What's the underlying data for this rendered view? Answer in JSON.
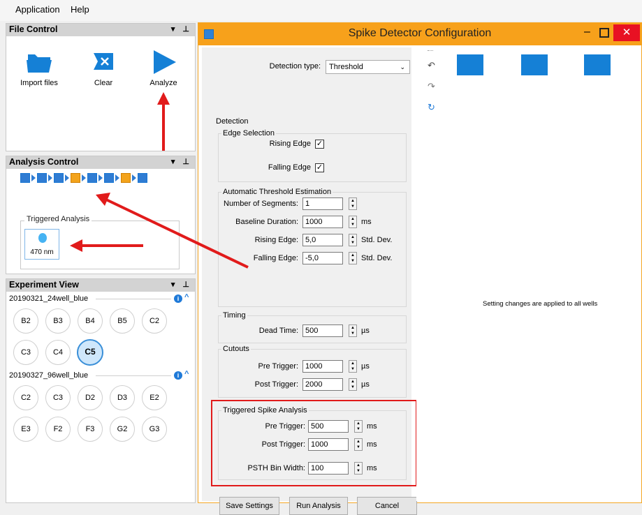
{
  "menu": {
    "items": [
      "Application",
      "Help"
    ]
  },
  "file_control": {
    "title": "File Control",
    "buttons": {
      "import": "Import files",
      "clear": "Clear",
      "analyze": "Analyze"
    }
  },
  "analysis_control": {
    "title": "Analysis Control",
    "triggered_title": "Triggered Analysis",
    "wavelength": "470 nm"
  },
  "experiment_view": {
    "title": "Experiment View",
    "groups": [
      {
        "name": "20190321_24well_blue",
        "rows": [
          [
            "B2",
            "B3",
            "B4",
            "B5",
            "C2"
          ],
          [
            "C3",
            "C4",
            "C5"
          ]
        ],
        "selected": "C5"
      },
      {
        "name": "20190327_96well_blue",
        "rows": [
          [
            "C2",
            "C3",
            "D2",
            "D3",
            "E2"
          ],
          [
            "E3",
            "F2",
            "F3",
            "G2",
            "G3"
          ]
        ]
      }
    ]
  },
  "dialog": {
    "title": "Spike Detector Configuration",
    "detection_type_label": "Detection type:",
    "detection_type_value": "Threshold",
    "detection_title": "Detection",
    "edge_selection_title": "Edge Selection",
    "rising_edge_label": "Rising Edge",
    "falling_edge_label": "Falling Edge",
    "auto_threshold_title": "Automatic Threshold Estimation",
    "num_segments_label": "Number of Segments:",
    "num_segments_value": "1",
    "baseline_label": "Baseline Duration:",
    "baseline_value": "1000",
    "baseline_unit": "ms",
    "rising_edge2_label": "Rising Edge:",
    "rising_edge2_value": "5,0",
    "falling_edge2_label": "Falling Edge:",
    "falling_edge2_value": "-5,0",
    "std_unit": "Std. Dev.",
    "timing_title": "Timing",
    "dead_time_label": "Dead Time:",
    "dead_time_value": "500",
    "us_unit": "µs",
    "cutouts_title": "Cutouts",
    "pre_trigger_label": "Pre Trigger:",
    "pre_trigger_value": "1000",
    "post_trigger_label": "Post Trigger:",
    "post_trigger_value": "2000",
    "triggered_title": "Triggered Spike Analysis",
    "tsa_pre_label": "Pre Trigger:",
    "tsa_pre_value": "500",
    "tsa_post_label": "Post Trigger:",
    "tsa_post_value": "1000",
    "psth_label": "PSTH Bin Width:",
    "psth_value": "100",
    "ms_unit": "ms",
    "save_button": "Save Settings",
    "run_button": "Run Analysis",
    "cancel_button": "Cancel",
    "right_note": "Setting changes are applied to all wells"
  },
  "colors": {
    "accent": "#f7a11b",
    "blue": "#1580d6",
    "red": "#e11b1b"
  }
}
